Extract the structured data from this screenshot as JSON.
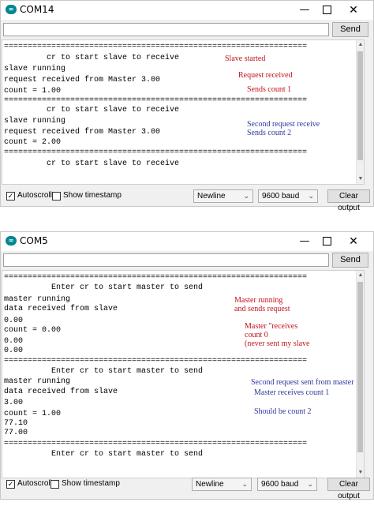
{
  "windows": [
    {
      "title": "COM14",
      "logo_text": "∞",
      "controls": {
        "minimize": "—",
        "close": "✕"
      },
      "send_label": "Send",
      "input_value": "",
      "output_lines": [
        "================================================================",
        "         cr to start slave to receive",
        "slave running",
        "request received from Master 3.00",
        "count = 1.00",
        "================================================================",
        "         cr to start slave to receive",
        "slave running",
        "request received from Master 3.00",
        "count = 2.00",
        "================================================================",
        "         cr to start slave to receive"
      ],
      "annotations": [
        {
          "text": "Slave started",
          "color": "red"
        },
        {
          "text": "Request received",
          "color": "red"
        },
        {
          "text": "Sends count 1",
          "color": "red"
        },
        {
          "text": "Second request receive\nSends count 2",
          "color": "blue"
        }
      ],
      "autoscroll": {
        "label": "Autoscroll",
        "checked": true
      },
      "timestamp": {
        "label": "Show timestamp",
        "checked": false
      },
      "line_ending": "Newline",
      "baud": "9600 baud",
      "clear_label": "Clear output"
    },
    {
      "title": "COM5",
      "logo_text": "∞",
      "controls": {
        "minimize": "—",
        "close": "✕"
      },
      "send_label": "Send",
      "input_value": "",
      "output_lines": [
        "================================================================",
        "          Enter cr to start master to send",
        "master running",
        "data received from slave",
        "0.00",
        "count = 0.00",
        "0.00",
        "0.00",
        "================================================================",
        "          Enter cr to start master to send",
        "master running",
        "data received from slave",
        "3.00",
        "count = 1.00",
        "77.10",
        "77.00",
        "================================================================",
        "          Enter cr to start master to send"
      ],
      "annotations": [
        {
          "text": "Master running\nand sends request",
          "color": "red"
        },
        {
          "text": "Master \"receives\ncount 0\n(never sent my slave",
          "color": "red"
        },
        {
          "text": "Second request sent from master",
          "color": "blue"
        },
        {
          "text": "Master receives count 1",
          "color": "blue"
        },
        {
          "text": "Should be count 2",
          "color": "blue"
        }
      ],
      "autoscroll": {
        "label": "Autoscroll",
        "checked": true
      },
      "timestamp": {
        "label": "Show timestamp",
        "checked": false
      },
      "line_ending": "Newline",
      "baud": "9600 baud",
      "clear_label": "Clear output"
    }
  ],
  "icons": {
    "checkmark": "✓",
    "caret": "⌄",
    "scroll_up": "▲",
    "scroll_down": "▼"
  }
}
